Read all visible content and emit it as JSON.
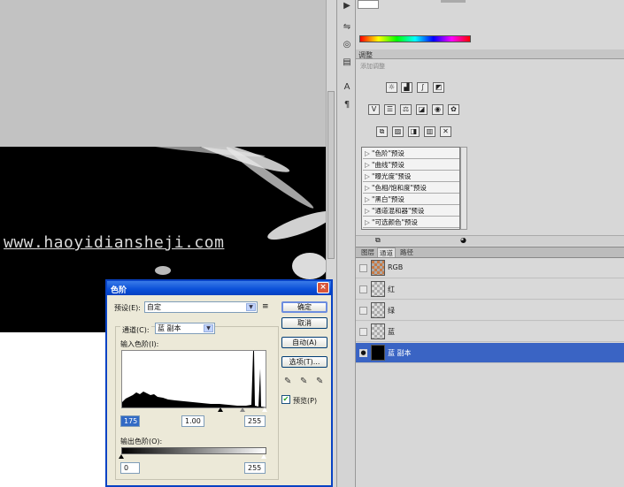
{
  "canvas": {
    "watermark": "www.haoyidiansheji.com"
  },
  "adjustments_panel": {
    "tab_label": "调整",
    "sub_label": "添加调整",
    "presets": [
      "\"色阶\"预设",
      "\"曲线\"预设",
      "\"曝光度\"预设",
      "\"色相/饱和度\"预设",
      "\"黑白\"预设",
      "\"通道混和器\"预设",
      "\"可选颜色\"预设"
    ]
  },
  "channels_panel": {
    "tabs": [
      "图层",
      "通道",
      "路径"
    ],
    "active_tab": "通道",
    "channels": [
      {
        "name": "RGB",
        "selected": false
      },
      {
        "name": "红",
        "selected": false
      },
      {
        "name": "绿",
        "selected": false
      },
      {
        "name": "蓝",
        "selected": false
      },
      {
        "name": "蓝 副本",
        "selected": true
      }
    ]
  },
  "levels_dialog": {
    "title": "色阶",
    "close_label": "×",
    "preset_label": "预设(E):",
    "preset_value": "自定",
    "preset_menu_icon": "≡",
    "channel_label": "通道(C):",
    "channel_value": "蓝 副本",
    "input_levels_label": "输入色阶(I):",
    "input_black": "175",
    "input_gamma": "1.00",
    "input_white": "255",
    "output_levels_label": "输出色阶(O):",
    "output_black": "0",
    "output_white": "255",
    "buttons": {
      "ok": "确定",
      "cancel": "取消",
      "auto": "自动(A)",
      "options": "选项(T)..."
    },
    "preview_label": "预览(P)",
    "preview_checked": true
  },
  "colors": {
    "dialog_title_blue": "#0a4fd8",
    "selected_row": "#3a64c4",
    "dialog_bg": "#ece9d8"
  }
}
